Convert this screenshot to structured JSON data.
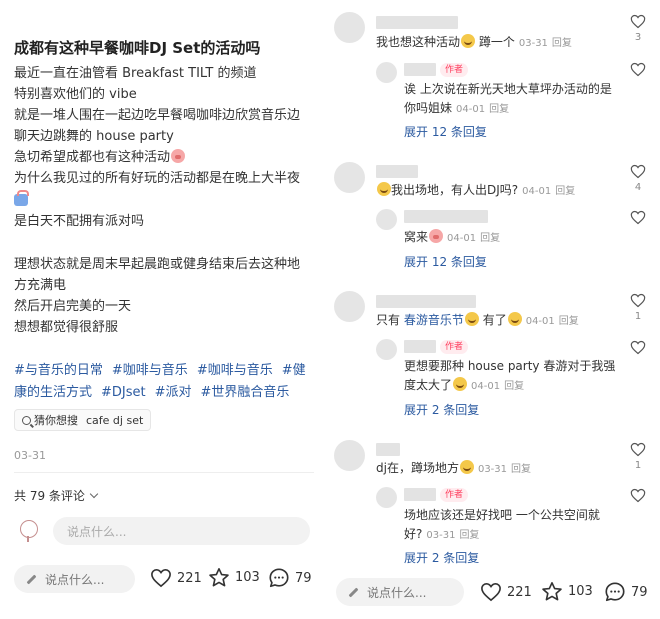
{
  "post": {
    "title": "成都有这种早餐咖啡DJ Set的活动吗",
    "lines": [
      "最近一直在油管看 Breakfast TILT 的频道",
      "特别喜欢他们的 vibe",
      "就是一堆人围在一起边吃早餐喝咖啡边欣赏音乐边",
      "聊天边跳舞的 house party",
      "急切希望成都也有这种活动",
      "为什么我见过的所有好玩的活动都是在晚上大半夜",
      "",
      "是白天不配拥有派对吗",
      "理想状态就是周末早起晨跑或健身结束后去这种地",
      "方充满电",
      "然后开启完美的一天",
      "想想都觉得很舒服"
    ],
    "tags": [
      "#与音乐的日常",
      "#咖啡与音乐",
      "#咖啡与音乐",
      "#健",
      "康的生活方式",
      "#DJset",
      "#派对",
      "#世界融合音乐"
    ],
    "guess_label": "猜你想搜",
    "guess_query": "cafe dj set",
    "date": "03-31",
    "total_comments": "共 79 条评论",
    "comment_placeholder": "说点什么..."
  },
  "bar": {
    "placeholder": "说点什么...",
    "likes": "221",
    "stars": "103",
    "comments": "79"
  },
  "comments": [
    {
      "text": "我也想这种活动",
      "text_tail": "蹲一个",
      "date": "03-31",
      "reply_label": "回复",
      "like_count": "3",
      "reply": {
        "author_tag": "作者",
        "line1": "诶 上次说在新光天地大草坪办活动的是",
        "line2": "你吗姐妹",
        "date": "04-01",
        "reply_label": "回复"
      },
      "expand": "展开 12 条回复"
    },
    {
      "text": "我出场地，有人出DJ吗?",
      "date": "04-01",
      "reply_label": "回复",
      "like_count": "4",
      "reply": {
        "line1": "窝来",
        "date": "04-01",
        "reply_label": "回复"
      },
      "expand": "展开 12 条回复"
    },
    {
      "text_pre": "只有",
      "text_link": "春游音乐节",
      "text_post": "有了",
      "date": "04-01",
      "reply_label": "回复",
      "like_count": "1",
      "reply": {
        "author_tag": "作者",
        "line1": "更想要那种 house party 春游对于我强",
        "line2": "度太大了",
        "date": "04-01",
        "reply_label": "回复"
      },
      "expand": "展开 2 条回复"
    },
    {
      "text": "dj在，蹲场地方",
      "date": "03-31",
      "reply_label": "回复",
      "like_count": "1",
      "reply": {
        "author_tag": "作者",
        "line1": "场地应该还是好找吧 一个公共空间就",
        "line2": "好?",
        "date": "03-31",
        "reply_label": "回复"
      },
      "expand": "展开 2 条回复"
    }
  ]
}
